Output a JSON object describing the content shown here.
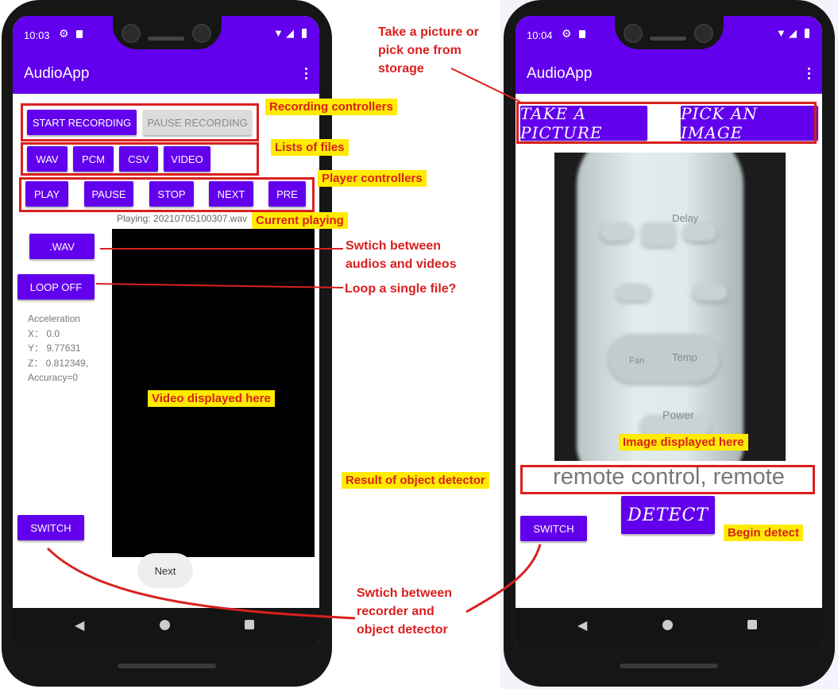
{
  "left_phone": {
    "status_time": "10:03",
    "app_title": "AudioApp",
    "recording": {
      "start": "START RECORDING",
      "pause": "PAUSE RECORDING"
    },
    "file_types": [
      "WAV",
      "PCM",
      "CSV",
      "VIDEO"
    ],
    "player": [
      "PLAY",
      "PAUSE",
      "STOP",
      "NEXT",
      "PRE"
    ],
    "playing_text": "Playing: 20210705100307.wav",
    "mode_button": ".WAV",
    "loop_button": "LOOP OFF",
    "sensor": {
      "title": "Acceleration",
      "x": "X： 0.0",
      "y": "Y： 9.77631",
      "z": "Z： 0.812349,",
      "accuracy": "Accuracy=0"
    },
    "switch_button": "SWITCH",
    "next_chip": "Next"
  },
  "right_phone": {
    "status_time": "10:04",
    "app_title": "AudioApp",
    "take_picture": "TAKE A PICTURE",
    "pick_image": "PICK AN IMAGE",
    "result_text": "remote control, remote",
    "detect_button": "DETECT",
    "switch_button": "SWITCH",
    "image_labels": {
      "delay": "Delay",
      "temp": "Temp",
      "power": "Power",
      "fan": "Fan"
    }
  },
  "annotations": {
    "recording_controllers": "Recording controllers",
    "lists_of_files": "Lists of files",
    "player_controllers": "Player controllers",
    "current_playing": "Current playing",
    "switch_av_1": "Swtich between",
    "switch_av_2": "audios and videos",
    "loop_single": "Loop a single file?",
    "video_displayed": "Video displayed here",
    "take_pick_1": "Take a picture or",
    "take_pick_2": "pick one from",
    "take_pick_3": "storage",
    "image_displayed": "Image displayed here",
    "result_detector": "Result of object detector",
    "begin_detect": "Begin detect",
    "switch_mode_1": "Swtich between",
    "switch_mode_2": "recorder and",
    "switch_mode_3": "object detector"
  },
  "colors": {
    "accent": "#6200ee",
    "annotation_red": "#d9201f",
    "highlight": "#ffeb00"
  }
}
